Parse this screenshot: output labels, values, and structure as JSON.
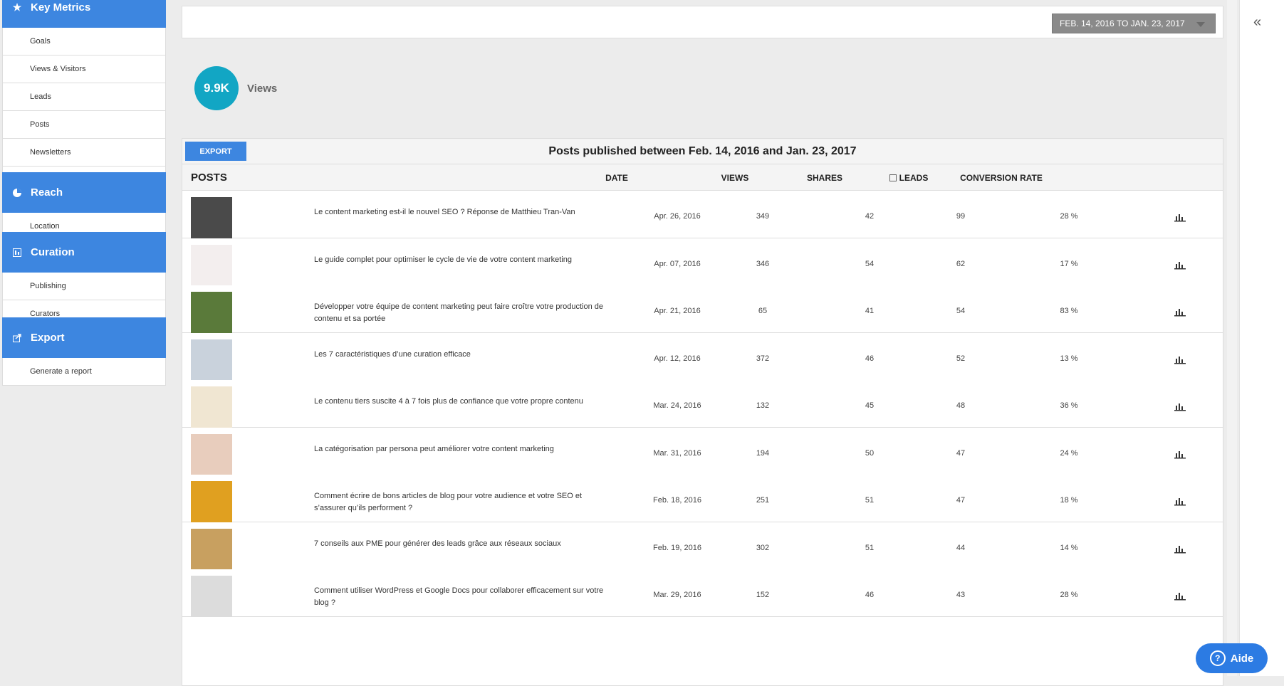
{
  "sidebar": {
    "key_metrics": {
      "title": "Key Metrics",
      "icon": "star-icon",
      "items": [
        "Goals",
        "Views & Visitors",
        "Leads",
        "Posts",
        "Newsletters"
      ]
    },
    "reach": {
      "title": "Reach",
      "icon": "pie-icon",
      "items": [
        "Location"
      ]
    },
    "curation": {
      "title": "Curation",
      "icon": "grid-icon",
      "items": [
        "Publishing",
        "Curators"
      ]
    },
    "export": {
      "title": "Export",
      "icon": "export-icon",
      "items": [
        "Generate a report"
      ]
    }
  },
  "date_range": "FEB. 14, 2016 TO JAN. 23, 2017",
  "summary": {
    "views_value": "9.9K",
    "views_label": "Views"
  },
  "table": {
    "export_label": "EXPORT",
    "title": "Posts published between Feb. 14, 2016 and Jan. 23, 2017",
    "headers": {
      "posts": "POSTS",
      "date": "DATE",
      "views": "VIEWS",
      "shares": "SHARES",
      "leads": "LEADS",
      "conversion": "CONVERSION RATE"
    },
    "rows": [
      {
        "title": "Le content marketing est-il le nouvel SEO ? Réponse de Matthieu Tran-Van",
        "date": "Apr. 26, 2016",
        "views": "349",
        "shares": "42",
        "leads": "99",
        "conversion": "28 %",
        "thumb_color": "#4a4a4a"
      },
      {
        "title": "Le guide complet pour optimiser le cycle de vie de votre content marketing",
        "date": "Apr. 07, 2016",
        "views": "346",
        "shares": "54",
        "leads": "62",
        "conversion": "17 %",
        "thumb_color": "#f3eeee"
      },
      {
        "title": "Développer votre équipe de content marketing peut faire croître votre production de contenu et sa portée",
        "date": "Apr. 21, 2016",
        "views": "65",
        "shares": "41",
        "leads": "54",
        "conversion": "83 %",
        "thumb_color": "#5a7a3a"
      },
      {
        "title": "Les 7 caractéristiques d’une curation efficace",
        "date": "Apr. 12, 2016",
        "views": "372",
        "shares": "46",
        "leads": "52",
        "conversion": "13 %",
        "thumb_color": "#c9d2dc"
      },
      {
        "title": "Le contenu tiers suscite 4 à 7 fois plus de confiance que votre propre contenu",
        "date": "Mar. 24, 2016",
        "views": "132",
        "shares": "45",
        "leads": "48",
        "conversion": "36 %",
        "thumb_color": "#f0e6d2"
      },
      {
        "title": "La catégorisation par persona peut améliorer votre content marketing",
        "date": "Mar. 31, 2016",
        "views": "194",
        "shares": "50",
        "leads": "47",
        "conversion": "24 %",
        "thumb_color": "#e8cdbd"
      },
      {
        "title": "Comment écrire de bons articles de blog pour votre audience et votre SEO et s’assurer qu’ils performent ?",
        "date": "Feb. 18, 2016",
        "views": "251",
        "shares": "51",
        "leads": "47",
        "conversion": "18 %",
        "thumb_color": "#e0a020"
      },
      {
        "title": "7 conseils aux PME pour générer des leads grâce aux réseaux sociaux",
        "date": "Feb. 19, 2016",
        "views": "302",
        "shares": "51",
        "leads": "44",
        "conversion": "14 %",
        "thumb_color": "#c8a060"
      },
      {
        "title": "Comment utiliser WordPress et Google Docs pour collaborer efficacement sur votre blog ?",
        "date": "Mar. 29, 2016",
        "views": "152",
        "shares": "46",
        "leads": "43",
        "conversion": "28 %",
        "thumb_color": "#dcdcdc"
      }
    ]
  },
  "right_panel": {
    "collapse_label": "«"
  },
  "help": {
    "label": "Aide",
    "icon": "question-icon"
  },
  "colors": {
    "primary": "#3d86e0",
    "accent": "#12a6c4",
    "date_button": "#8a8a8a"
  }
}
